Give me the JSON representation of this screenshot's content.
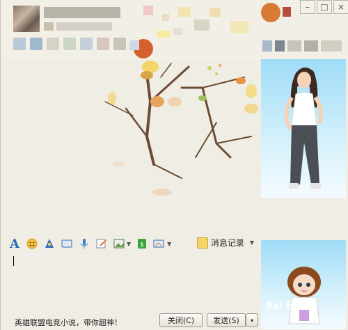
{
  "window": {
    "controls": [
      "–",
      "□",
      "×"
    ]
  },
  "input_toolbar": {
    "font_label": "A",
    "history_label": "消息记录"
  },
  "footer": {
    "ad_text": "英雄联盟电竞小说，带你超神！",
    "close_label": "关闭(C)",
    "send_label": "发送(S)",
    "send_menu_label": "▾"
  },
  "watermark": {
    "text": "Bai 经验"
  },
  "colors": {
    "window_bg": "#efede4",
    "avatar_bg": "#c9ecfb",
    "branch": "#6b4b33",
    "leaf_orange": "#e2933a"
  }
}
